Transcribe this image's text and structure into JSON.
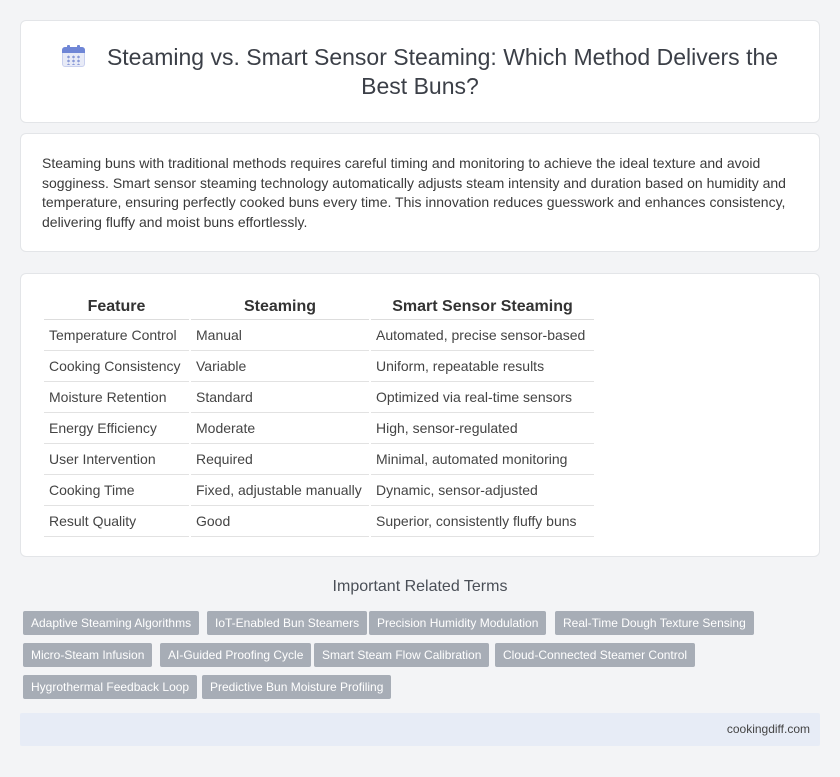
{
  "page": {
    "title": "Steaming vs. Smart Sensor Steaming: Which Method Delivers the Best Buns?",
    "icon": "calendar-icon",
    "intro": "Steaming buns with traditional methods requires careful timing and monitoring to achieve the ideal texture and avoid sogginess. Smart sensor steaming technology automatically adjusts steam intensity and duration based on humidity and temperature, ensuring perfectly cooked buns every time. This innovation reduces guesswork and enhances consistency, delivering fluffy and moist buns effortlessly."
  },
  "table": {
    "headers": [
      "Feature",
      "Steaming",
      "Smart Sensor Steaming"
    ],
    "rows": [
      [
        "Temperature Control",
        "Manual",
        "Automated, precise sensor-based"
      ],
      [
        "Cooking Consistency",
        "Variable",
        "Uniform, repeatable results"
      ],
      [
        "Moisture Retention",
        "Standard",
        "Optimized via real-time sensors"
      ],
      [
        "Energy Efficiency",
        "Moderate",
        "High, sensor-regulated"
      ],
      [
        "User Intervention",
        "Required",
        "Minimal, automated monitoring"
      ],
      [
        "Cooking Time",
        "Fixed, adjustable manually",
        "Dynamic, sensor-adjusted"
      ],
      [
        "Result Quality",
        "Good",
        "Superior, consistently fluffy buns"
      ]
    ]
  },
  "related": {
    "title": "Important Related Terms",
    "tags": [
      "Adaptive Steaming Algorithms",
      "IoT-Enabled Bun Steamers",
      "Precision Humidity Modulation",
      "Real-Time Dough Texture Sensing",
      "Micro-Steam Infusion",
      "AI-Guided Proofing Cycle",
      "Smart Steam Flow Calibration",
      "Cloud-Connected Steamer Control",
      "Hygrothermal Feedback Loop",
      "Predictive Bun Moisture Profiling"
    ]
  },
  "footer": {
    "site": "cookingdiff.com"
  },
  "colors": {
    "tag_bg": "#a7adb6",
    "footer_bg": "#e7ecf6",
    "page_bg": "#f3f4f6"
  }
}
